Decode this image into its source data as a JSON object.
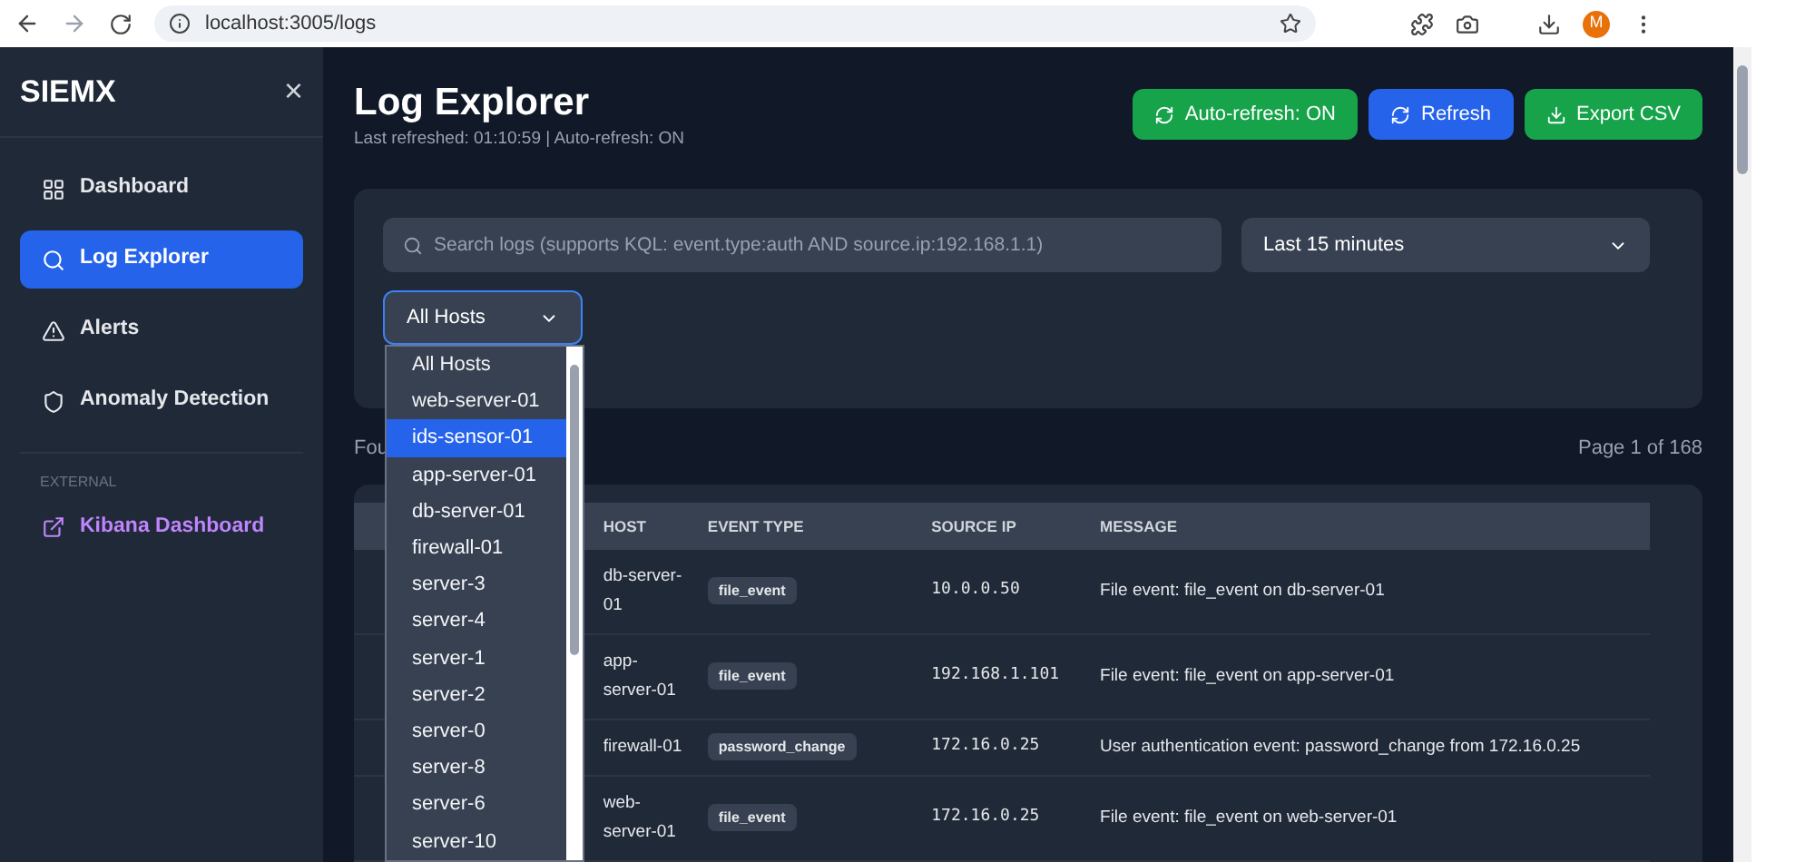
{
  "browser": {
    "url": "localhost:3005/logs",
    "avatar": "M"
  },
  "sidebar": {
    "brand": "SIEMX",
    "close": "×",
    "items": [
      {
        "label": "Dashboard",
        "kind": "grid",
        "selected": false
      },
      {
        "label": "Log Explorer",
        "kind": "search",
        "selected": true
      },
      {
        "label": "Alerts",
        "kind": "alert",
        "selected": false
      },
      {
        "label": "Anomaly Detection",
        "kind": "shield",
        "selected": false
      }
    ],
    "section": "EXTERNAL",
    "external_link": "Kibana Dashboard"
  },
  "header": {
    "title": "Log Explorer",
    "subtitle": "Last refreshed: 01:10:59 | Auto-refresh: ON",
    "buttons": [
      {
        "label": "Auto-refresh: ON",
        "kind": "auto"
      },
      {
        "label": "Refresh",
        "kind": "refresh"
      },
      {
        "label": "Export CSV",
        "kind": "export"
      }
    ]
  },
  "filters": {
    "search_placeholder": "Search logs (supports KQL: event.type:auth AND source.ip:192.168.1.1)",
    "time_range": "Last 15 minutes",
    "host_select": "All Hosts",
    "host_options": [
      {
        "label": "All Hosts",
        "selected": false
      },
      {
        "label": "web-server-01",
        "selected": false
      },
      {
        "label": "ids-sensor-01",
        "selected": true
      },
      {
        "label": "app-server-01",
        "selected": false
      },
      {
        "label": "db-server-01",
        "selected": false
      },
      {
        "label": "firewall-01",
        "selected": false
      },
      {
        "label": "server-3",
        "selected": false
      },
      {
        "label": "server-4",
        "selected": false
      },
      {
        "label": "server-1",
        "selected": false
      },
      {
        "label": "server-2",
        "selected": false
      },
      {
        "label": "server-0",
        "selected": false
      },
      {
        "label": "server-8",
        "selected": false
      },
      {
        "label": "server-6",
        "selected": false
      },
      {
        "label": "server-10",
        "selected": false
      }
    ]
  },
  "results": {
    "found": "Fou",
    "page": "Page 1 of 168"
  },
  "table": {
    "columns": [
      "HOST",
      "EVENT TYPE",
      "SOURCE IP",
      "MESSAGE"
    ],
    "rows": [
      {
        "host": "db-server-01",
        "event_type": "file_event",
        "source_ip": "10.0.0.50",
        "message": "File event: file_event on db-server-01"
      },
      {
        "host": "app-server-01",
        "event_type": "file_event",
        "source_ip": "192.168.1.101",
        "message": "File event: file_event on app-server-01"
      },
      {
        "host": "firewall-01",
        "event_type": "password_change",
        "source_ip": "172.16.0.25",
        "message": "User authentication event: password_change from 172.16.0.25"
      },
      {
        "host": "web-server-01",
        "event_type": "file_event",
        "source_ip": "172.16.0.25",
        "message": "File event: file_event on web-server-01"
      }
    ]
  }
}
